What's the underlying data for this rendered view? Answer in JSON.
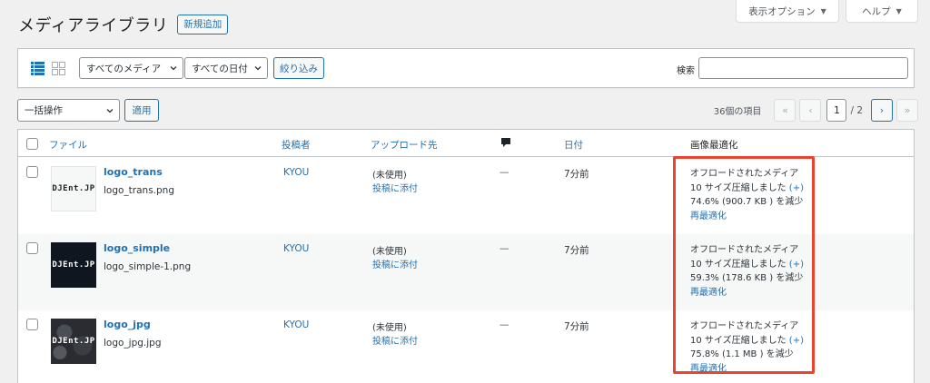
{
  "header": {
    "title": "メディアライブラリ",
    "add_new": "新規追加",
    "screen_options": "表示オプション",
    "help": "ヘルプ"
  },
  "filters": {
    "media_type": "すべてのメディア",
    "date": "すべての日付",
    "filter_button": "絞り込み",
    "search_label": "検索",
    "search_value": ""
  },
  "bulk": {
    "action": "一括操作",
    "apply": "適用"
  },
  "pagination": {
    "items_count": "36個の項目",
    "first": "«",
    "prev": "‹",
    "current_page": "1",
    "total": "/ 2",
    "next": "›",
    "last": "»"
  },
  "table": {
    "columns": {
      "file": "ファイル",
      "author": "投稿者",
      "uploaded_to": "アップロード先",
      "date": "日付",
      "optimization": "画像最適化"
    },
    "rows": [
      {
        "title": "logo_trans",
        "filename": "logo_trans.png",
        "thumb_text": "DJEnt.JP",
        "author": "KYOU",
        "unused": "(未使用)",
        "attach": "投稿に添付",
        "comments": "—",
        "date": "7分前",
        "opt_line1": "オフロードされたメディア",
        "opt_line2": "10 サイズ圧縮しました",
        "opt_plus": "(+)",
        "opt_line3": "74.6% (900.7 KB ) を減少",
        "reoptimize": "再最適化"
      },
      {
        "title": "logo_simple",
        "filename": "logo_simple-1.png",
        "thumb_text": "DJEnt.JP",
        "author": "KYOU",
        "unused": "(未使用)",
        "attach": "投稿に添付",
        "comments": "—",
        "date": "7分前",
        "opt_line1": "オフロードされたメディア",
        "opt_line2": "10 サイズ圧縮しました",
        "opt_plus": "(+)",
        "opt_line3": "59.3% (178.6 KB ) を減少",
        "reoptimize": "再最適化"
      },
      {
        "title": "logo_jpg",
        "filename": "logo_jpg.jpg",
        "thumb_text": "DJEnt.JP",
        "author": "KYOU",
        "unused": "(未使用)",
        "attach": "投稿に添付",
        "comments": "—",
        "date": "7分前",
        "opt_line1": "オフロードされたメディア",
        "opt_line2": "10 サイズ圧縮しました",
        "opt_plus": "(+)",
        "opt_line3": "75.8% (1.1 MB ) を減少",
        "reoptimize": "再最適化"
      }
    ]
  },
  "colors": {
    "link": "#2271b1",
    "highlight": "#e8452c"
  }
}
